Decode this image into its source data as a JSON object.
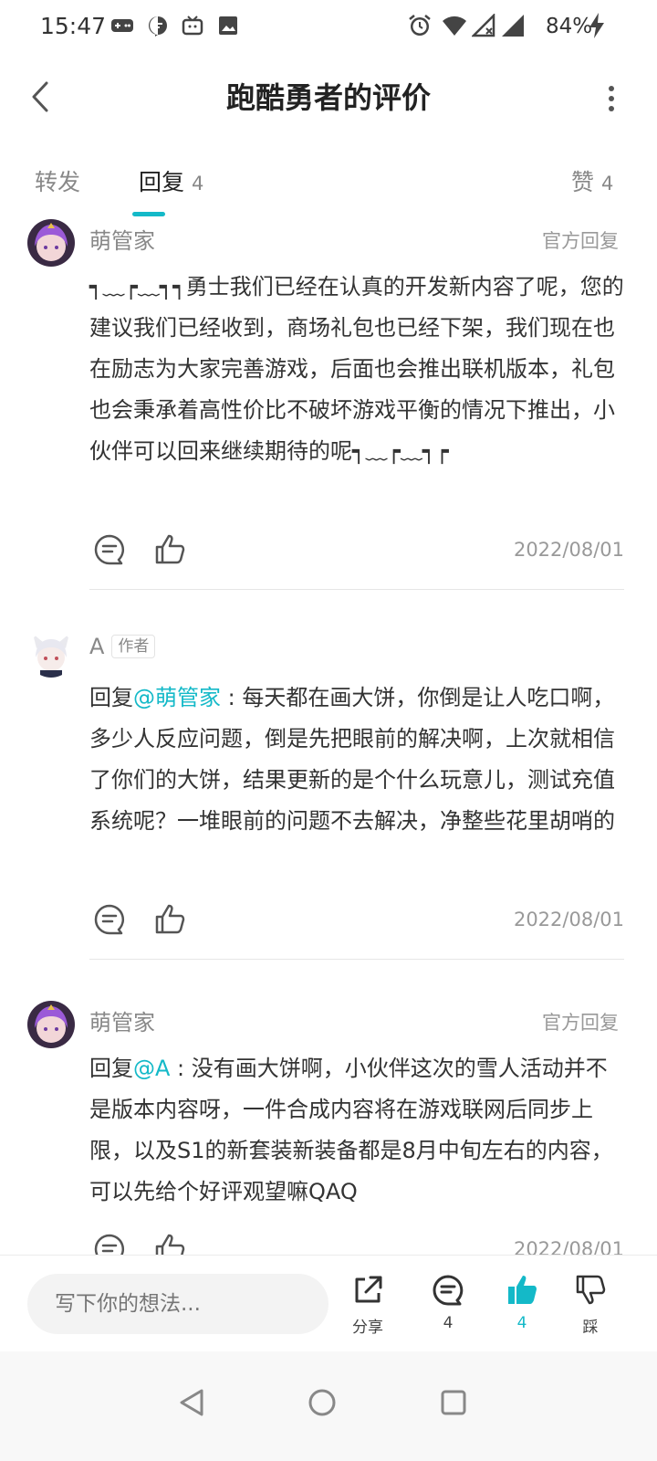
{
  "status_bar": {
    "time": "15:47",
    "battery": "84%",
    "icons": [
      "game-controller-icon",
      "message-icon",
      "tv-icon",
      "image-icon",
      "alarm-icon",
      "wifi-icon",
      "no-signal-icon",
      "signal-icon",
      "charging-icon"
    ]
  },
  "header": {
    "title": "跑酷勇者的评价"
  },
  "tabs": {
    "repost": "转发",
    "reply": "回复",
    "reply_count": "4",
    "like": "赞",
    "like_count": "4"
  },
  "comments": [
    {
      "name": "萌管家",
      "tag": "官方回复",
      "text": "┑﹏┍﹏┑┑勇士我们已经在认真的开发新内容了呢，您的建议我们已经收到，商场礼包也已经下架，我们现在也在励志为大家完善游戏，后面也会推出联机版本，礼包也会秉承着高性价比不破坏游戏平衡的情况下推出，小伙伴可以回来继续期待的呢┑﹏┍﹏┑┍",
      "date": "2022/08/01"
    },
    {
      "name": "A",
      "author_tag": "作者",
      "reply_prefix": "回复",
      "mention": "@萌管家",
      "text": " : 每天都在画大饼，你倒是让人吃口啊，多少人反应问题，倒是先把眼前的解决啊，上次就相信了你们的大饼，结果更新的是个什么玩意儿，测试充值系统呢？一堆眼前的问题不去解决，净整些花里胡哨的",
      "date": "2022/08/01"
    },
    {
      "name": "萌管家",
      "tag": "官方回复",
      "reply_prefix": "回复",
      "mention": "@A",
      "text": " : 没有画大饼啊，小伙伴这次的雪人活动并不是版本内容呀，一件合成内容将在游戏联网后同步上限，以及S1的新套装新装备都是8月中旬左右的内容，可以先给个好评观望嘛QAQ",
      "date": "2022/08/01"
    }
  ],
  "bottom_bar": {
    "input_placeholder": "写下你的想法...",
    "share_label": "分享",
    "reply_count": "4",
    "like_count": "4",
    "dislike_label": "踩",
    "accent_color": "#14b9c8"
  }
}
